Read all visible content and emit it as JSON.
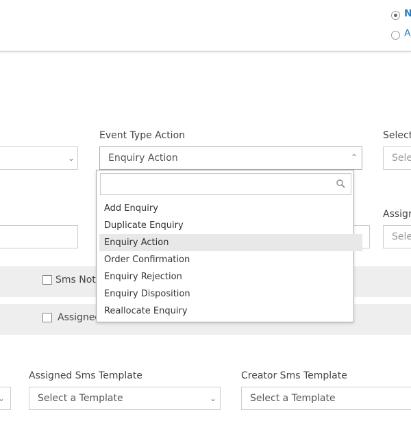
{
  "header": {
    "radio_options": [
      {
        "label": "N",
        "checked": true
      },
      {
        "label": "A",
        "checked": false
      }
    ]
  },
  "fields": {
    "event_type_action": {
      "label": "Event Type Action",
      "value": "Enquiry Action"
    },
    "select_right": {
      "label": "Select",
      "placeholder": "Sele"
    },
    "assign_right": {
      "label": "Assign",
      "placeholder": "Sele"
    },
    "assigned_sms_template": {
      "label": "Assigned Sms Template",
      "placeholder": "Select a Template"
    },
    "creator_sms_template": {
      "label": "Creator Sms Template",
      "placeholder": "Select a Template"
    }
  },
  "checkbox_rows": [
    {
      "label": "Sms Noti",
      "checked": false
    },
    {
      "label": "Assigned",
      "checked": false
    }
  ],
  "dropdown": {
    "search_value": "",
    "items": [
      "Add Enquiry",
      "Duplicate Enquiry",
      "Enquiry Action",
      "Order Confirmation",
      "Enquiry Rejection",
      "Enquiry Disposition",
      "Reallocate Enquiry"
    ],
    "highlighted": "Enquiry Action"
  },
  "colors": {
    "accent": "#2b7fc5",
    "row_bg": "#eeeeee",
    "highlight": "#e8e8e8"
  }
}
